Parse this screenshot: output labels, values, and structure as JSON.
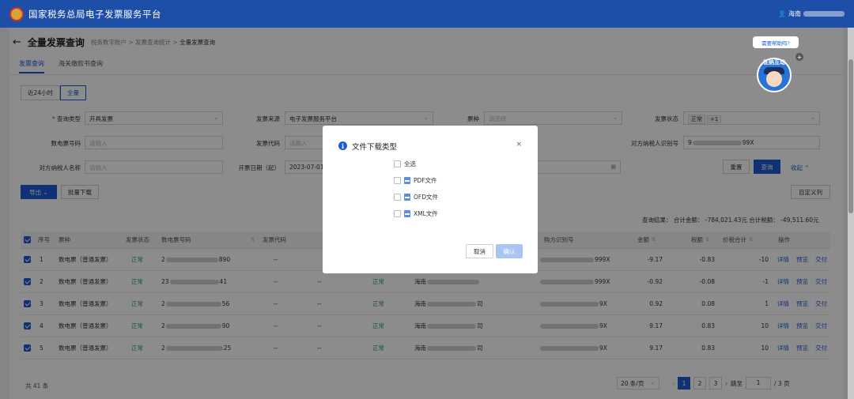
{
  "header": {
    "title": "国家税务总局电子发票服务平台",
    "user_prefix": "海南"
  },
  "page": {
    "back_icon": "arrow-left-icon",
    "title": "全量发票查询",
    "breadcrumb": [
      "税务数字账户",
      "发票查询统计",
      "全量发票查询"
    ],
    "breadcrumb_sep": ">",
    "tabs": [
      {
        "label": "发票查询",
        "active": true
      },
      {
        "label": "海关缴款书查询",
        "active": false
      }
    ]
  },
  "time_filter": {
    "options": [
      "近24小时",
      "全量"
    ],
    "selected": "全量"
  },
  "form": {
    "query_type": {
      "label": "查询类型",
      "value": "开具发票"
    },
    "source": {
      "label": "发票来源",
      "value": "电子发票服务平台"
    },
    "ticket_type": {
      "label": "票种",
      "placeholder": "请选择"
    },
    "status": {
      "label": "发票状态",
      "tag": "正常",
      "more": "+1"
    },
    "einvoice_no": {
      "label": "数电票号码",
      "placeholder": "请输入"
    },
    "invoice_code": {
      "label": "发票代码",
      "placeholder": "请输入"
    },
    "buyer_tax_id": {
      "label": "对方纳税人识别号",
      "value_start": "9",
      "value_end": "99X"
    },
    "buyer_name": {
      "label": "对方纳税人名称",
      "placeholder": "请输入"
    },
    "date_start": {
      "label": "开票日期（起）",
      "value": "2023-07-01"
    }
  },
  "actions": {
    "reset": "重置",
    "query": "查询",
    "collapse": "收起",
    "export": "导出",
    "batch_download": "批量下载",
    "custom_columns": "自定义列"
  },
  "summary": {
    "text": "查询结果：  合计金额：  -784,021.43元    合计税额：  -49,511.60元"
  },
  "table": {
    "columns": [
      "序号",
      "票种",
      "发票状态",
      "数电票号码",
      "发票代码",
      "",
      "",
      "",
      "",
      "金额",
      "税额",
      "价税合计",
      "操作"
    ],
    "buyer_id_header": "购方识别号",
    "rows": [
      {
        "no": "1",
        "type": "数电票（普通发票）",
        "status": "正常",
        "num_start": "2",
        "num_end": "890",
        "code": "--",
        "name_end": "",
        "id_end": "999X",
        "amount": "-9.17",
        "tax": "-0.83",
        "total": "-10"
      },
      {
        "no": "2",
        "type": "数电票（普通发票）",
        "status": "正常",
        "num_start": "23",
        "num_end": "41",
        "code": "--",
        "name_end": "",
        "id_end": "999X",
        "amount": "-0.92",
        "tax": "-0.08",
        "total": "-1"
      },
      {
        "no": "3",
        "type": "数电票（普通发票）",
        "status": "正常",
        "num_start": "2",
        "num_end": "56",
        "code": "--",
        "name_end": "司",
        "id_end": "9X",
        "amount": "0.92",
        "tax": "0.08",
        "total": "1"
      },
      {
        "no": "4",
        "type": "数电票（普通发票）",
        "status": "正常",
        "num_start": "2",
        "num_end": "90",
        "code": "--",
        "name_end": "司",
        "id_end": "9X",
        "amount": "9.17",
        "tax": "0.83",
        "total": "10"
      },
      {
        "no": "5",
        "type": "数电票（普通发票）",
        "status": "正常",
        "num_start": "2",
        "num_end": "25",
        "code": "--",
        "name_end": "司",
        "id_end": "9X",
        "amount": "9.17",
        "tax": "0.83",
        "total": "10"
      }
    ],
    "buyer_name_prefix": "海南",
    "row_actions": [
      "详情",
      "预览",
      "交付"
    ],
    "empty_dash": "--"
  },
  "pagination": {
    "total": "共 41 条",
    "page_size": "20 条/页",
    "pages": [
      "1",
      "2",
      "3"
    ],
    "current": "1",
    "goto_label": "跳至",
    "goto_value": "1",
    "total_pages": "/ 3 页",
    "prev_icon": "chevron-left-icon",
    "next_icon": "chevron-right-icon"
  },
  "modal": {
    "title": "文件下载类型",
    "options": [
      {
        "label": "全选",
        "icon": false
      },
      {
        "label": "PDF文件",
        "icon": true
      },
      {
        "label": "OFD文件",
        "icon": true
      },
      {
        "label": "XML文件",
        "icon": true
      }
    ],
    "cancel": "取消",
    "confirm": "确认",
    "close_symbol": "×",
    "info_symbol": "i"
  },
  "help": {
    "bubble": "需要帮助吗?",
    "mascot_text": "征纳互动",
    "plus": "+"
  },
  "colors": {
    "primary": "#1e5bd3",
    "header": "#1e4fa8",
    "success": "#2e9e4b"
  }
}
